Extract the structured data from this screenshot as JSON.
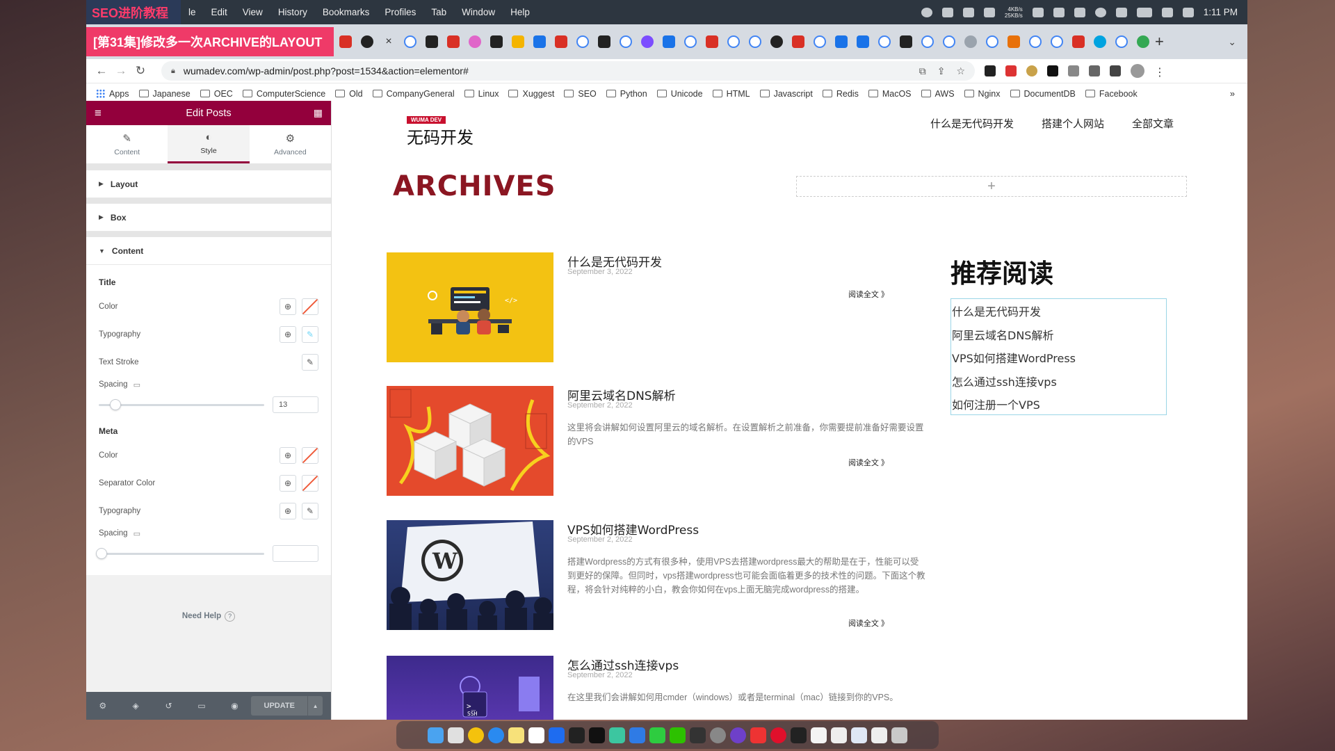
{
  "menubar": {
    "overlay_title": "SEO进阶教程",
    "app_fragment": "le",
    "items": [
      "Edit",
      "View",
      "History",
      "Bookmarks",
      "Profiles",
      "Tab",
      "Window",
      "Help"
    ],
    "net_up": "4KB/s",
    "net_down": "25KB/s",
    "time": "1:11 PM"
  },
  "tabs": {
    "active_banner": "[第31集]修改多一次ARCHIVE的LAYOUT",
    "close_glyph": "×"
  },
  "address": {
    "url": "wumadev.com/wp-admin/post.php?post=1534&action=elementor#"
  },
  "bookmarks": [
    "Apps",
    "Japanese",
    "OEC",
    "ComputerScience",
    "Old",
    "CompanyGeneral",
    "Linux",
    "Xuggest",
    "SEO",
    "Python",
    "Unicode",
    "HTML",
    "Javascript",
    "Redis",
    "MacOS",
    "AWS",
    "Nginx",
    "DocumentDB",
    "Facebook"
  ],
  "editor": {
    "title": "Edit Posts",
    "tabs": [
      {
        "label": "Content",
        "icon": "pencil-icon"
      },
      {
        "label": "Style",
        "icon": "contrast-icon"
      },
      {
        "label": "Advanced",
        "icon": "gear-icon"
      }
    ],
    "sections": {
      "layout": "Layout",
      "box": "Box",
      "content": "Content"
    },
    "title_group": {
      "heading": "Title",
      "color": "Color",
      "typography": "Typography",
      "text_stroke": "Text Stroke",
      "spacing": "Spacing",
      "spacing_value": "13",
      "spacing_fraction": 0.1
    },
    "meta_group": {
      "heading": "Meta",
      "color": "Color",
      "separator_color": "Separator Color",
      "typography": "Typography",
      "spacing": "Spacing",
      "spacing_value": ""
    },
    "need_help": "Need Help",
    "update": "UPDATE"
  },
  "site": {
    "logo_badge": "WUMA DEV",
    "logo_text": "无码开发",
    "nav": [
      "什么是无代码开发",
      "搭建个人网站",
      "全部文章"
    ],
    "archives_heading": "ARCHIVES",
    "add_glyph": "+",
    "read_more": "阅读全文 》",
    "posts": [
      {
        "title": "什么是无代码开发",
        "date": "September 3, 2022",
        "excerpt": ""
      },
      {
        "title": "阿里云域名DNS解析",
        "date": "September 2, 2022",
        "excerpt": "这里将会讲解如何设置阿里云的域名解析。在设置解析之前准备，你需要提前准备好需要设置的VPS"
      },
      {
        "title": "VPS如何搭建WordPress",
        "date": "September 2, 2022",
        "excerpt": "搭建Wordpress的方式有很多种，使用VPS去搭建wordpress最大的帮助是在于，性能可以受到更好的保障。但同时，vps搭建wordpress也可能会面临着更多的技术性的问题。下面这个教程，将会针对纯粹的小白，教会你如何在vps上面无脑完成wordpress的搭建。"
      },
      {
        "title": "怎么通过ssh连接vps",
        "date": "September 2, 2022",
        "excerpt": "在这里我们会讲解如何用cmder（windows）或者是terminal（mac）链接到你的VPS。"
      }
    ],
    "sidebar_heading": "推荐阅读",
    "sidebar_links": [
      "什么是无代码开发",
      "阿里云域名DNS解析",
      "VPS如何搭建WordPress",
      "怎么通过ssh连接vps",
      "如何注册一个VPS"
    ]
  },
  "colors": {
    "elementor_accent": "#93003c",
    "archives_red": "#8b1622",
    "banner_pink": "#ef3a68"
  }
}
